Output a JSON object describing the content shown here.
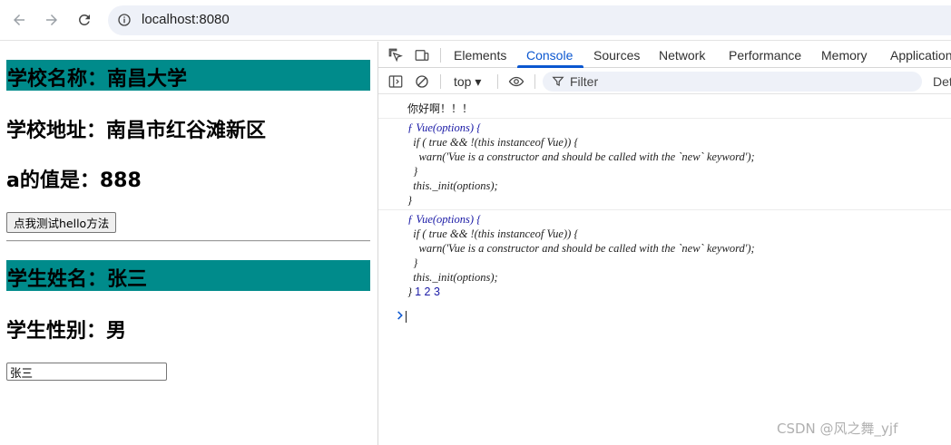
{
  "browser": {
    "url": "localhost:8080"
  },
  "page": {
    "school_name": "学校名称：南昌大学",
    "school_address": "学校地址：南昌市红谷滩新区",
    "a_value": "a的值是：888",
    "hello_button": "点我测试hello方法",
    "student_name": "学生姓名：张三",
    "student_gender": "学生性别：男",
    "name_input_value": "张三"
  },
  "devtools": {
    "tabs": [
      {
        "label": "Elements"
      },
      {
        "label": "Console"
      },
      {
        "label": "Sources"
      },
      {
        "label": "Network"
      },
      {
        "label": "Performance"
      },
      {
        "label": "Memory"
      },
      {
        "label": "Application"
      }
    ],
    "active_tab": "Console",
    "toolbar": {
      "context": "top",
      "filter_placeholder": "Filter",
      "levels_label": "Det"
    },
    "console": {
      "greeting": "你好啊！！！",
      "fn1": [
        "ƒ Vue(options) {",
        "  if ( true && !(this instanceof Vue)) {",
        "    warn('Vue is a constructor and should be called with the `new` keyword');",
        "  }",
        "  this._init(options);",
        "}"
      ],
      "fn2": [
        "ƒ Vue(options) {",
        "  if ( true && !(this instanceof Vue)) {",
        "    warn('Vue is a constructor and should be called with the `new` keyword');",
        "  }",
        "  this._init(options);",
        "}"
      ],
      "fn2_trailing": "1 2 3"
    }
  },
  "watermark": "CSDN @风之舞_yjf",
  "colors": {
    "title_bg": "#008b8b",
    "devtools_accent": "#0b57d0"
  }
}
